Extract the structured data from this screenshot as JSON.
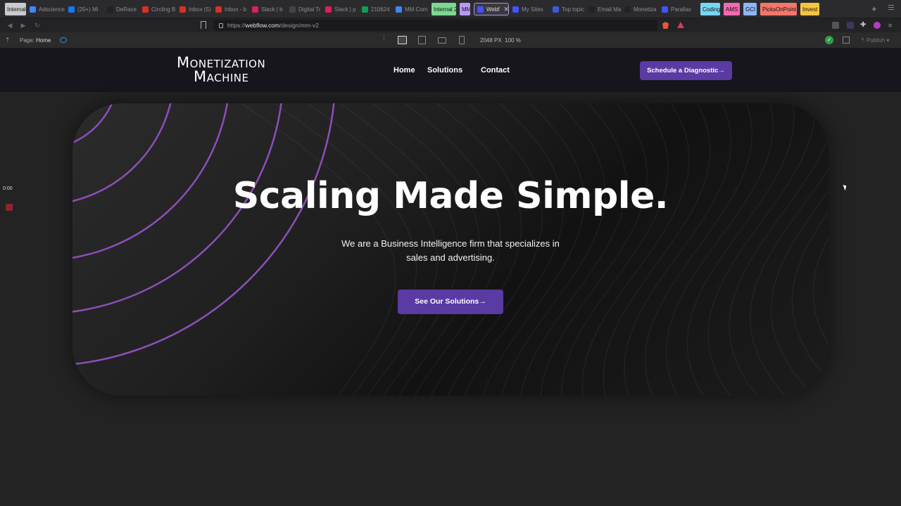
{
  "browser": {
    "tabs": [
      {
        "label": "Internal",
        "group": true,
        "color": "#c9c9cf"
      },
      {
        "label": "Adscience",
        "color": "#4285f4"
      },
      {
        "label": "(20+) Mi",
        "color": "#1877f2"
      },
      {
        "label": "DeRace",
        "color": "#222222"
      },
      {
        "label": "Circling B",
        "color": "#d93025"
      },
      {
        "label": "Inbox (5)",
        "color": "#d93025"
      },
      {
        "label": "Inbox - b",
        "color": "#d93025"
      },
      {
        "label": "Slack | b",
        "color": "#e01e5a"
      },
      {
        "label": "Digital Tr",
        "color": "#444444"
      },
      {
        "label": "Slack | p",
        "color": "#e01e5a"
      },
      {
        "label": "210624",
        "color": "#0f9d58"
      },
      {
        "label": "MM Com",
        "color": "#4285f4"
      },
      {
        "label": "Internal 2",
        "group": true,
        "color": "#7cd992"
      },
      {
        "label": "MM",
        "group": true,
        "color": "#b99af5"
      },
      {
        "label": "Webf",
        "active": true,
        "color": "#4353ff"
      },
      {
        "label": "My Sites",
        "color": "#4353ff"
      },
      {
        "label": "Top topic",
        "color": "#3b5bdb"
      },
      {
        "label": "Email Ma",
        "color": "#222222"
      },
      {
        "label": "Monetiza",
        "color": "#222222"
      },
      {
        "label": "Parallax",
        "color": "#4353ff"
      },
      {
        "label": "Coding",
        "group": true,
        "color": "#78d6f0"
      },
      {
        "label": "AMS",
        "group": true,
        "color": "#f06bb1"
      },
      {
        "label": "GCI",
        "group": true,
        "color": "#8fb6f5"
      },
      {
        "label": "PicksOnPoint",
        "group": true,
        "color": "#f2776b"
      },
      {
        "label": "Invest",
        "group": true,
        "color": "#f5c542"
      }
    ],
    "close_glyph": "✕",
    "new_tab_glyph": "+",
    "url_prefix": "https://",
    "url_host": "webflow.com",
    "url_path": "/design/mm-v2"
  },
  "designer": {
    "page_label": "Page:",
    "page_name": "Home",
    "canvas_width": "2048 PX",
    "zoom": "100 %",
    "publish_label": "Publish"
  },
  "site": {
    "logo_line1_big": "M",
    "logo_line1_rest": "ONETIZATION",
    "logo_line2_big": "M",
    "logo_line2_rest": "ACHINE",
    "nav": {
      "home": "Home",
      "solutions": "Solutions",
      "contact": "Contact"
    },
    "nav_cta": "Schedule a Diagnostic→",
    "hero_title": "Scaling Made Simple.",
    "hero_subtitle": "We are a Business Intelligence firm that specializes in sales and advertising.",
    "hero_cta": "See Our Solutions→",
    "accent_color": "#5a3aa3",
    "arc_color": "#8a4fb8"
  },
  "recorder": {
    "time": "0:00"
  }
}
